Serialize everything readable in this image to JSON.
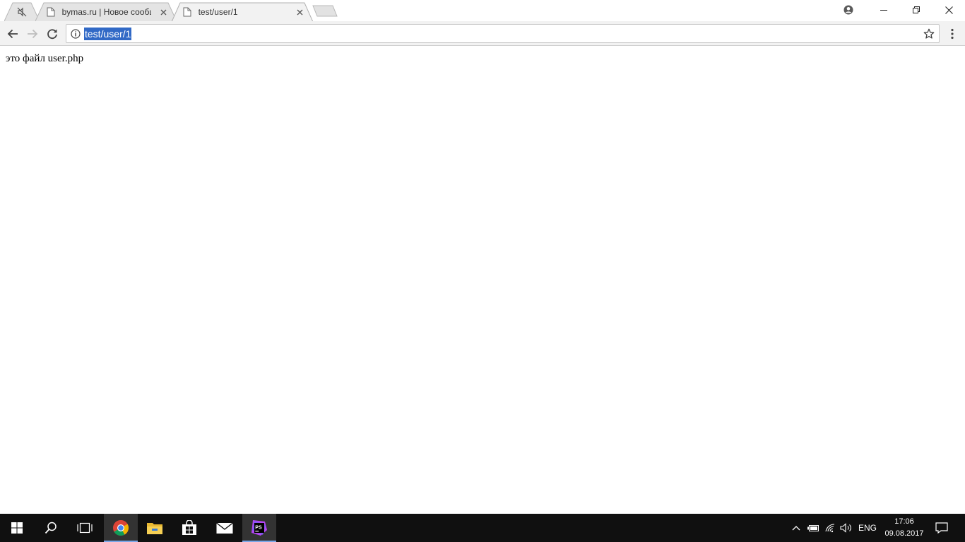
{
  "browser": {
    "tabs": [
      {
        "title": "",
        "muted": true
      },
      {
        "title": "bymas.ru | Новое сообщ"
      },
      {
        "title": "test/user/1",
        "active": true
      }
    ],
    "address": "test/user/1"
  },
  "page": {
    "text": "это файл user.php"
  },
  "taskbar": {
    "language": "ENG",
    "time": "17:06",
    "date": "09.08.2017"
  },
  "colors": {
    "selection": "#3169c6",
    "taskbar": "#101010",
    "taskbar_active": "#333333",
    "toolbar": "#f2f2f2"
  },
  "icons": [
    "muted-speaker-icon",
    "page-icon",
    "close-icon",
    "profile-icon",
    "minimize-icon",
    "restore-icon",
    "window-close-icon",
    "back-icon",
    "forward-icon",
    "reload-icon",
    "info-icon",
    "star-icon",
    "menu-icon",
    "windows-start-icon",
    "search-icon",
    "task-view-icon",
    "chrome-icon",
    "file-explorer-icon",
    "store-icon",
    "mail-icon",
    "phpstorm-icon",
    "chevron-up-icon",
    "battery-icon",
    "wifi-icon",
    "volume-icon",
    "notification-icon"
  ]
}
